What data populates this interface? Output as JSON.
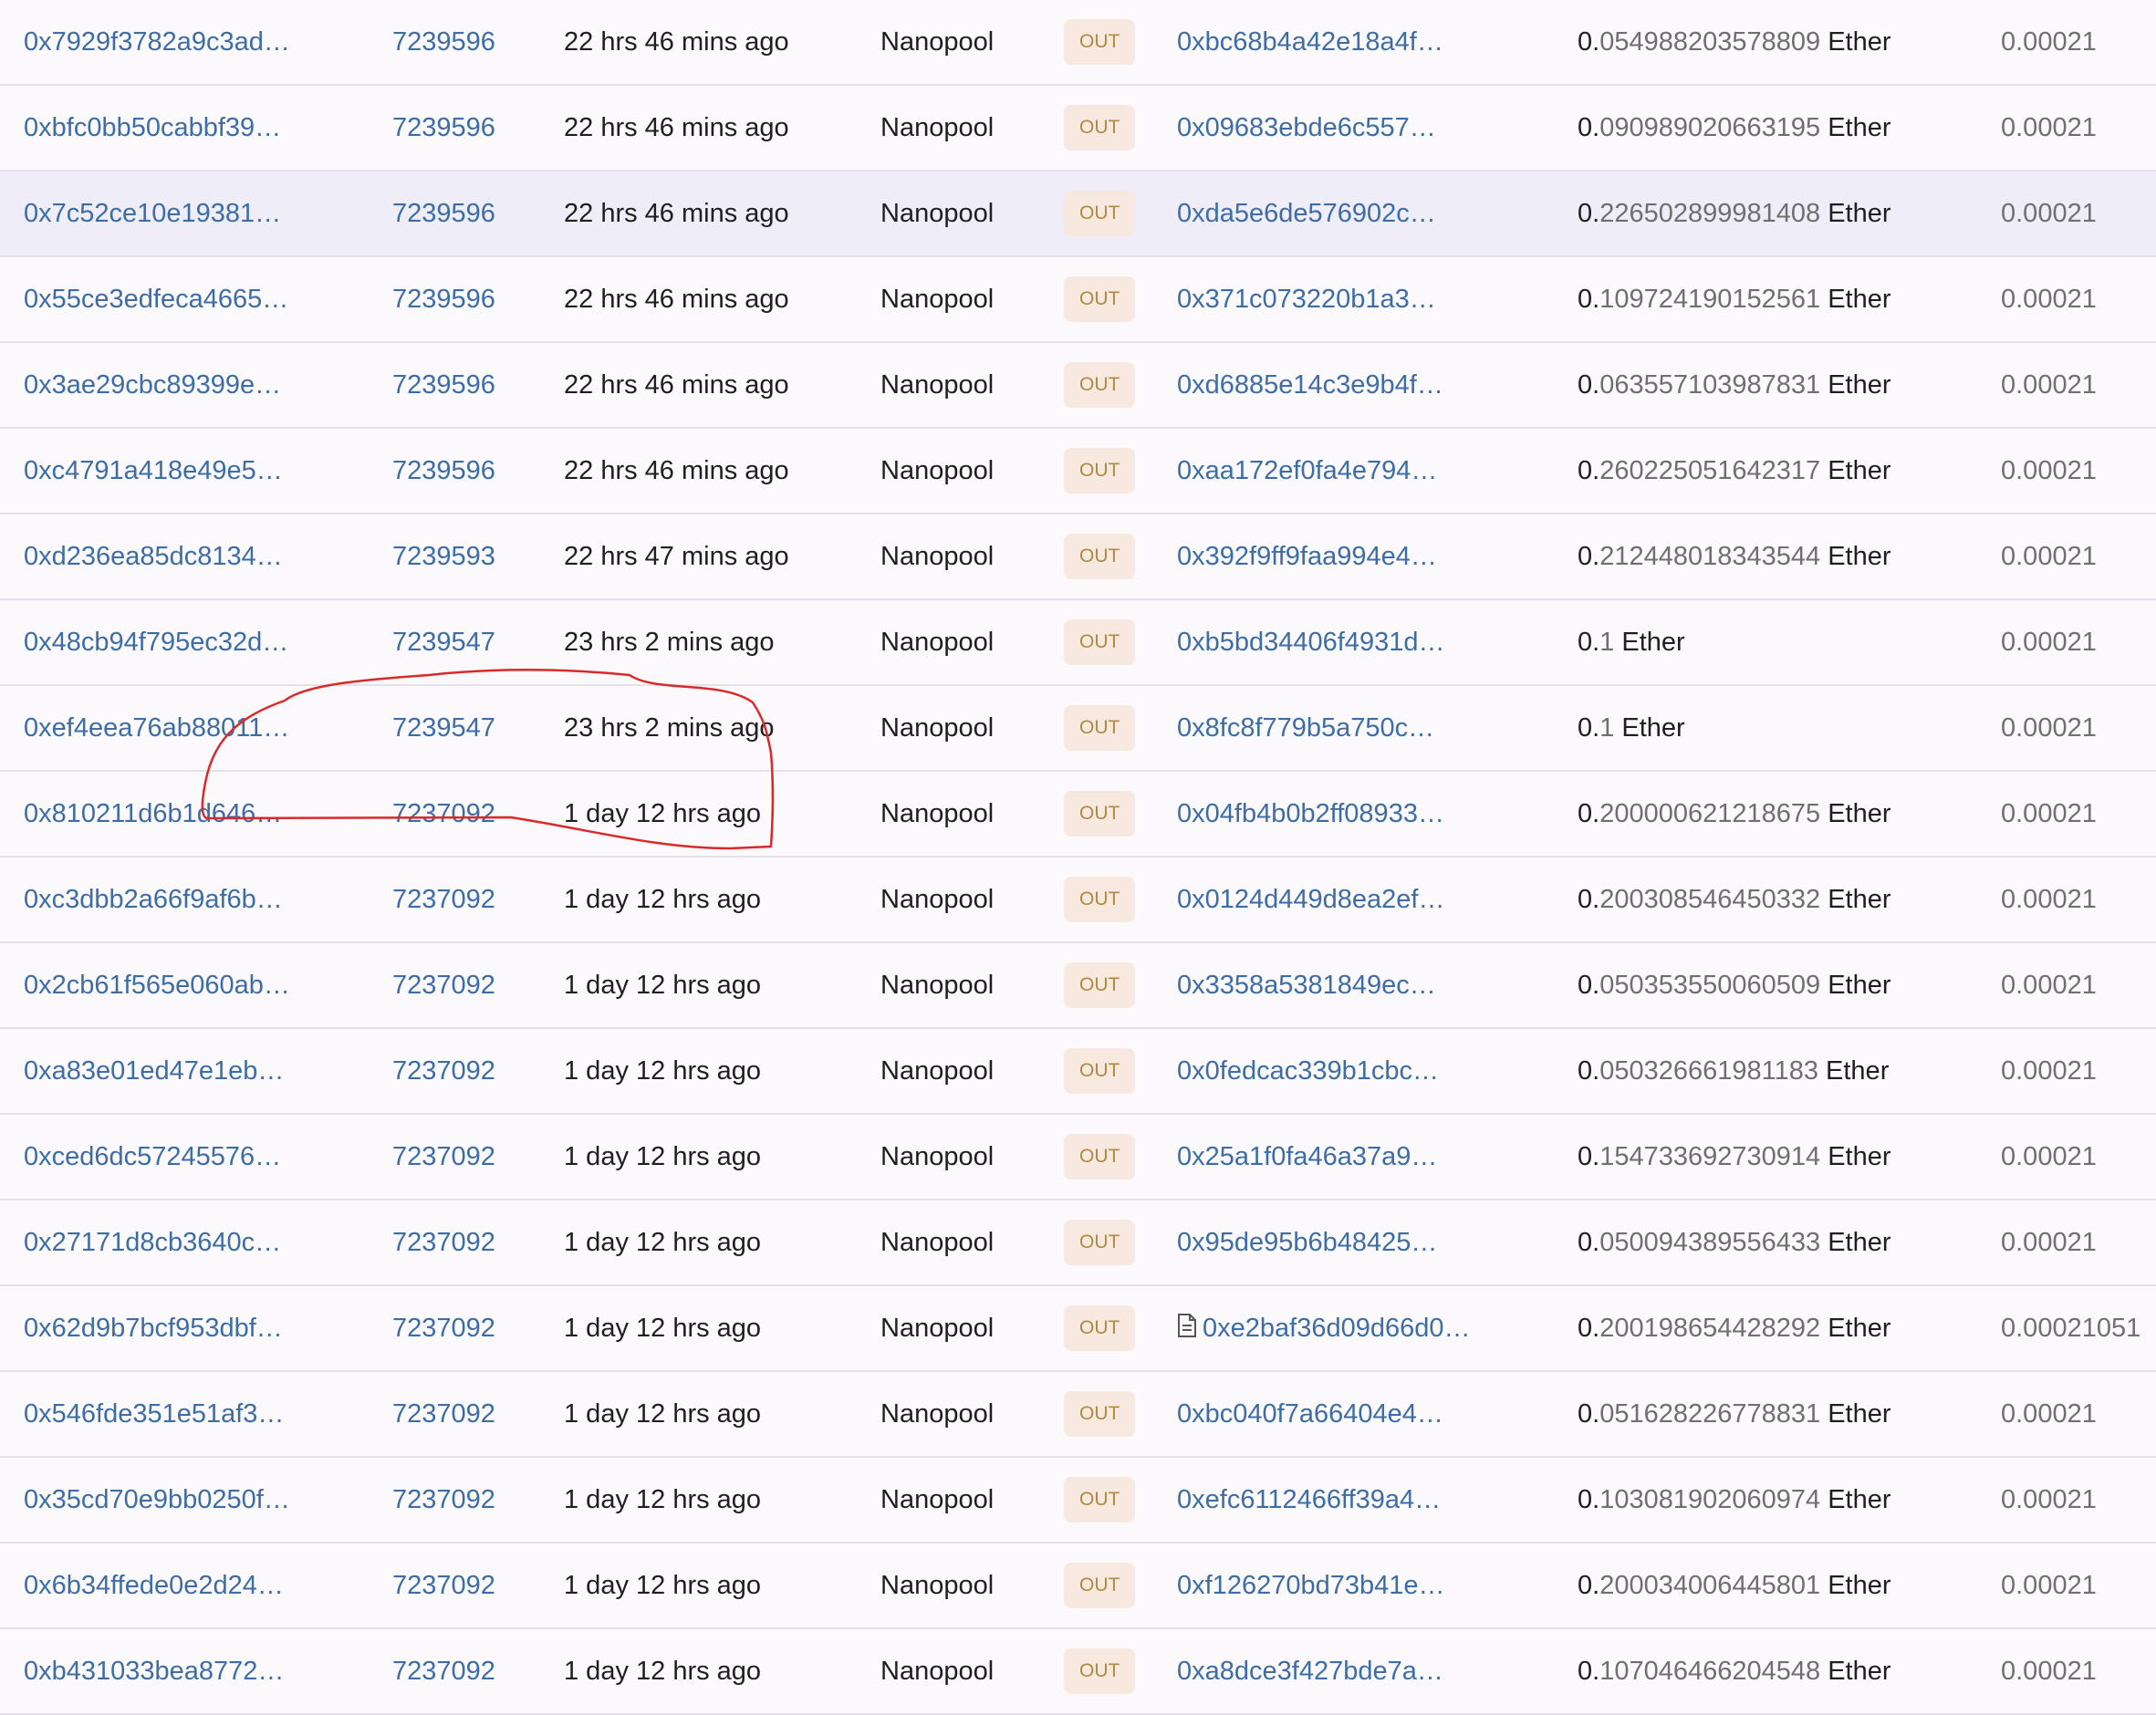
{
  "table": {
    "rows": [
      {
        "hash": "0x7929f3782a9c3ad…",
        "block": "7239596",
        "age": "22 hrs 46 mins ago",
        "from": "Nanopool",
        "direction": "OUT",
        "to": "0xbc68b4a42e18a4f…",
        "to_is_contract": false,
        "value_lead": "0.",
        "value_rest": "054988203578809",
        "value_unit": "Ether",
        "fee": "0.00021"
      },
      {
        "hash": "0xbfc0bb50cabbf39…",
        "block": "7239596",
        "age": "22 hrs 46 mins ago",
        "from": "Nanopool",
        "direction": "OUT",
        "to": "0x09683ebde6c557…",
        "to_is_contract": false,
        "value_lead": "0.",
        "value_rest": "090989020663195",
        "value_unit": "Ether",
        "fee": "0.00021"
      },
      {
        "hash": "0x7c52ce10e19381…",
        "block": "7239596",
        "age": "22 hrs 46 mins ago",
        "from": "Nanopool",
        "direction": "OUT",
        "to": "0xda5e6de576902c…",
        "to_is_contract": false,
        "value_lead": "0.",
        "value_rest": "226502899981408",
        "value_unit": "Ether",
        "fee": "0.00021"
      },
      {
        "hash": "0x55ce3edfeca4665…",
        "block": "7239596",
        "age": "22 hrs 46 mins ago",
        "from": "Nanopool",
        "direction": "OUT",
        "to": "0x371c073220b1a3…",
        "to_is_contract": false,
        "value_lead": "0.",
        "value_rest": "109724190152561",
        "value_unit": "Ether",
        "fee": "0.00021"
      },
      {
        "hash": "0x3ae29cbc89399e…",
        "block": "7239596",
        "age": "22 hrs 46 mins ago",
        "from": "Nanopool",
        "direction": "OUT",
        "to": "0xd6885e14c3e9b4f…",
        "to_is_contract": false,
        "value_lead": "0.",
        "value_rest": "063557103987831",
        "value_unit": "Ether",
        "fee": "0.00021"
      },
      {
        "hash": "0xc4791a418e49e5…",
        "block": "7239596",
        "age": "22 hrs 46 mins ago",
        "from": "Nanopool",
        "direction": "OUT",
        "to": "0xaa172ef0fa4e794…",
        "to_is_contract": false,
        "value_lead": "0.",
        "value_rest": "260225051642317",
        "value_unit": "Ether",
        "fee": "0.00021"
      },
      {
        "hash": "0xd236ea85dc8134…",
        "block": "7239593",
        "age": "22 hrs 47 mins ago",
        "from": "Nanopool",
        "direction": "OUT",
        "to": "0x392f9ff9faa994e4…",
        "to_is_contract": false,
        "value_lead": "0.",
        "value_rest": "212448018343544",
        "value_unit": "Ether",
        "fee": "0.00021"
      },
      {
        "hash": "0x48cb94f795ec32d…",
        "block": "7239547",
        "age": "23 hrs 2 mins ago",
        "from": "Nanopool",
        "direction": "OUT",
        "to": "0xb5bd34406f4931d…",
        "to_is_contract": false,
        "value_lead": "0.",
        "value_rest": "1",
        "value_unit": "Ether",
        "fee": "0.00021"
      },
      {
        "hash": "0xef4eea76ab88011…",
        "block": "7239547",
        "age": "23 hrs 2 mins ago",
        "from": "Nanopool",
        "direction": "OUT",
        "to": "0x8fc8f779b5a750c…",
        "to_is_contract": false,
        "value_lead": "0.",
        "value_rest": "1",
        "value_unit": "Ether",
        "fee": "0.00021"
      },
      {
        "hash": "0x810211d6b1d646…",
        "block": "7237092",
        "age": "1 day 12 hrs ago",
        "from": "Nanopool",
        "direction": "OUT",
        "to": "0x04fb4b0b2ff08933…",
        "to_is_contract": false,
        "value_lead": "0.",
        "value_rest": "200000621218675",
        "value_unit": "Ether",
        "fee": "0.00021"
      },
      {
        "hash": "0xc3dbb2a66f9af6b…",
        "block": "7237092",
        "age": "1 day 12 hrs ago",
        "from": "Nanopool",
        "direction": "OUT",
        "to": "0x0124d449d8ea2ef…",
        "to_is_contract": false,
        "value_lead": "0.",
        "value_rest": "200308546450332",
        "value_unit": "Ether",
        "fee": "0.00021"
      },
      {
        "hash": "0x2cb61f565e060ab…",
        "block": "7237092",
        "age": "1 day 12 hrs ago",
        "from": "Nanopool",
        "direction": "OUT",
        "to": "0x3358a5381849ec…",
        "to_is_contract": false,
        "value_lead": "0.",
        "value_rest": "050353550060509",
        "value_unit": "Ether",
        "fee": "0.00021"
      },
      {
        "hash": "0xa83e01ed47e1eb…",
        "block": "7237092",
        "age": "1 day 12 hrs ago",
        "from": "Nanopool",
        "direction": "OUT",
        "to": "0x0fedcac339b1cbc…",
        "to_is_contract": false,
        "value_lead": "0.",
        "value_rest": "050326661981183",
        "value_unit": "Ether",
        "fee": "0.00021"
      },
      {
        "hash": "0xced6dc57245576…",
        "block": "7237092",
        "age": "1 day 12 hrs ago",
        "from": "Nanopool",
        "direction": "OUT",
        "to": "0x25a1f0fa46a37a9…",
        "to_is_contract": false,
        "value_lead": "0.",
        "value_rest": "154733692730914",
        "value_unit": "Ether",
        "fee": "0.00021"
      },
      {
        "hash": "0x27171d8cb3640c…",
        "block": "7237092",
        "age": "1 day 12 hrs ago",
        "from": "Nanopool",
        "direction": "OUT",
        "to": "0x95de95b6b48425…",
        "to_is_contract": false,
        "value_lead": "0.",
        "value_rest": "050094389556433",
        "value_unit": "Ether",
        "fee": "0.00021"
      },
      {
        "hash": "0x62d9b7bcf953dbf…",
        "block": "7237092",
        "age": "1 day 12 hrs ago",
        "from": "Nanopool",
        "direction": "OUT",
        "to": "0xe2baf36d09d66d0…",
        "to_is_contract": true,
        "value_lead": "0.",
        "value_rest": "200198654428292",
        "value_unit": "Ether",
        "fee": "0.00021051"
      },
      {
        "hash": "0x546fde351e51af3…",
        "block": "7237092",
        "age": "1 day 12 hrs ago",
        "from": "Nanopool",
        "direction": "OUT",
        "to": "0xbc040f7a66404e4…",
        "to_is_contract": false,
        "value_lead": "0.",
        "value_rest": "051628226778831",
        "value_unit": "Ether",
        "fee": "0.00021"
      },
      {
        "hash": "0x35cd70e9bb0250f…",
        "block": "7237092",
        "age": "1 day 12 hrs ago",
        "from": "Nanopool",
        "direction": "OUT",
        "to": "0xefc6112466ff39a4…",
        "to_is_contract": false,
        "value_lead": "0.",
        "value_rest": "103081902060974",
        "value_unit": "Ether",
        "fee": "0.00021"
      },
      {
        "hash": "0x6b34ffede0e2d24…",
        "block": "7237092",
        "age": "1 day 12 hrs ago",
        "from": "Nanopool",
        "direction": "OUT",
        "to": "0xf126270bd73b41e…",
        "to_is_contract": false,
        "value_lead": "0.",
        "value_rest": "200034006445801",
        "value_unit": "Ether",
        "fee": "0.00021"
      },
      {
        "hash": "0xb431033bea8772…",
        "block": "7237092",
        "age": "1 day 12 hrs ago",
        "from": "Nanopool",
        "direction": "OUT",
        "to": "0xa8dce3f427bde7a…",
        "to_is_contract": false,
        "value_lead": "0.",
        "value_rest": "107046466204548",
        "value_unit": "Ether",
        "fee": "0.00021"
      }
    ],
    "highlighted_row": 2
  },
  "annotation": {
    "color": "#d92a2a",
    "shape": "hand-drawn-loop"
  },
  "colors": {
    "link": "#3d6da6",
    "badge_bg": "#f7e9df",
    "badge_text": "#b08a40",
    "row_bg": "#fcf9fc",
    "row_highlight": "#efedf7"
  }
}
